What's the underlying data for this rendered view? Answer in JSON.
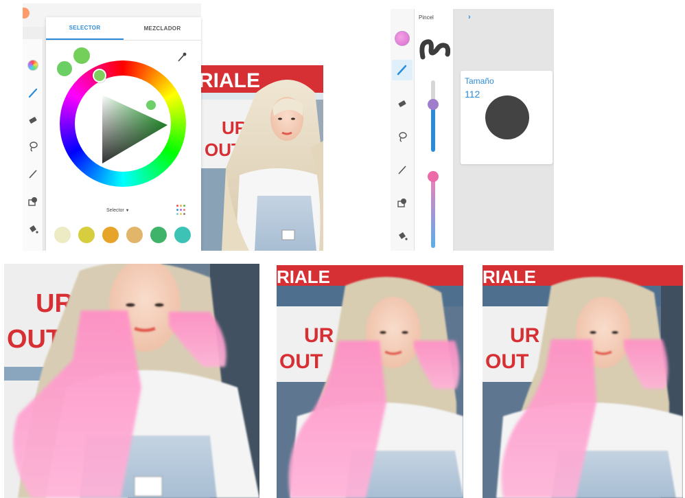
{
  "color_picker": {
    "tabs": [
      {
        "label": "SELECTOR",
        "active": true
      },
      {
        "label": "MEZCLADOR",
        "active": false
      }
    ],
    "mode_dropdown": "Selector",
    "swatches": [
      "#ecebc4",
      "#d6cd3f",
      "#e6a42a",
      "#e2b66a",
      "#3fb36a",
      "#3cc3b5"
    ],
    "accent": "#2b8bd8"
  },
  "sign_text": {
    "top": "RIALE",
    "line1": "UR",
    "line2": "OUT"
  },
  "brush_panel": {
    "header": "Pincel",
    "size_label": "Tamaño",
    "size_value": "112"
  },
  "icons": {
    "tools": [
      "color-icon",
      "brush-icon",
      "eraser-icon",
      "lasso-icon",
      "pen-icon",
      "fill-shape-icon",
      "bucket-icon"
    ]
  },
  "colors": {
    "pink_hair": "#ff9fd0",
    "sign_red": "#d62f34"
  }
}
